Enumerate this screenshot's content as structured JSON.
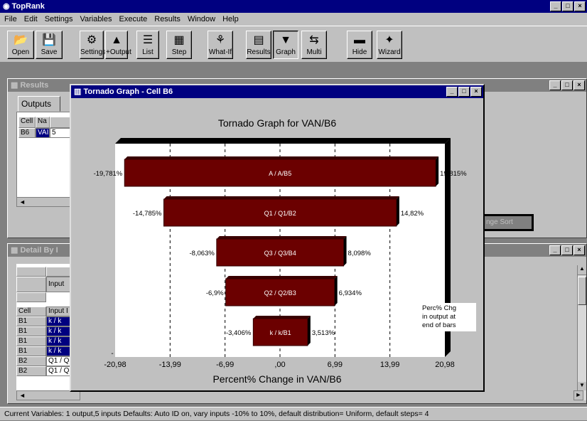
{
  "app": {
    "title": "TopRank",
    "menu": [
      "File",
      "Edit",
      "Settings",
      "Variables",
      "Execute",
      "Results",
      "Window",
      "Help"
    ]
  },
  "toolbar": [
    {
      "label": "Open",
      "icon": "open-icon"
    },
    {
      "label": "Save",
      "icon": "save-icon"
    },
    {
      "label": "Settings",
      "icon": "settings-icon"
    },
    {
      "label": "+Output",
      "icon": "add-output-icon"
    },
    {
      "label": "List",
      "icon": "list-icon"
    },
    {
      "label": "Step",
      "icon": "step-icon"
    },
    {
      "label": "What-If",
      "icon": "what-if-icon"
    },
    {
      "label": "Results",
      "icon": "results-icon"
    },
    {
      "label": "Graph",
      "icon": "graph-icon"
    },
    {
      "label": "Multi",
      "icon": "multi-icon"
    },
    {
      "label": "Hide",
      "icon": "hide-icon"
    },
    {
      "label": "Wizard",
      "icon": "wizard-icon"
    }
  ],
  "results_window": {
    "title": "Results",
    "tab": "Outputs",
    "col_cell": "Cell",
    "col_name": "Na",
    "row_cell": "B6",
    "row_name": "VAI",
    "row_val": "5",
    "sort_btn": "nge Sort"
  },
  "detail_window": {
    "title": "Detail By I",
    "input_hdr": "Input",
    "col_cell": "Cell",
    "col_input": "Input I",
    "rows": [
      {
        "cell": "B1",
        "input": "k / k"
      },
      {
        "cell": "B1",
        "input": "k / k"
      },
      {
        "cell": "B1",
        "input": "k / k"
      },
      {
        "cell": "B1",
        "input": "k / k"
      },
      {
        "cell": "B2",
        "input": "Q1 / Q"
      },
      {
        "cell": "B2",
        "input": "Q1 / Q"
      }
    ]
  },
  "tornado_window": {
    "title": "Tornado Graph - Cell B6",
    "note": [
      "Perc% Chg",
      "in output at",
      "end of bars"
    ]
  },
  "chart_data": {
    "type": "bar",
    "orientation": "horizontal",
    "title": "Tornado Graph for VAN/B6",
    "xlabel": "Percent% Change in VAN/B6",
    "xlim": [
      -20.98,
      20.98
    ],
    "xticks": [
      "-20,98",
      "-13,99",
      "-6,99",
      ",00",
      "6,99",
      "13,99",
      "20,98"
    ],
    "categories": [
      "A / A/B5",
      "Q1 / Q1/B2",
      "Q3 / Q3/B4",
      "Q2 / Q2/B3",
      "k / k/B1"
    ],
    "low": [
      -19.781,
      -14.785,
      -8.063,
      -6.9,
      -3.406
    ],
    "high": [
      19.815,
      14.82,
      8.098,
      6.934,
      3.513
    ],
    "low_labels": [
      "-19,781%",
      "-14,785%",
      "-8,063%",
      "-6,9%",
      "-3,406%"
    ],
    "high_labels": [
      "19,815%",
      "14,82%",
      "8,098%",
      "6,934%",
      "3,513%"
    ],
    "bar_color": "#6b0000"
  },
  "status": "Current Variables: 1 output,5 inputs     Defaults:  Auto ID on,  vary inputs -10% to 10%,  default distribution= Uniform,  default steps= 4"
}
